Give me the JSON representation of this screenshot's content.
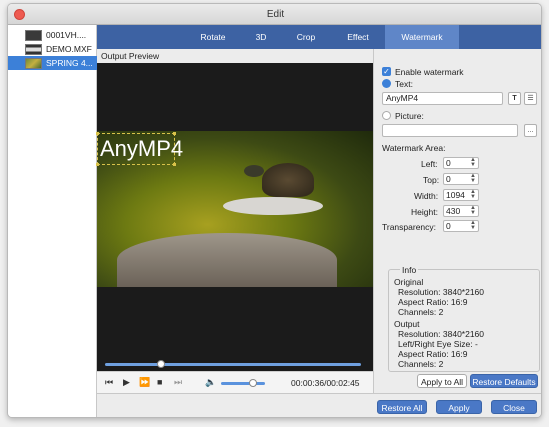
{
  "window": {
    "title": "Edit"
  },
  "files": [
    {
      "name": "0001VH...."
    },
    {
      "name": "DEMO.MXF"
    },
    {
      "name": "SPRING 4..."
    }
  ],
  "tabs": [
    "Rotate",
    "3D",
    "Crop",
    "Effect",
    "Watermark"
  ],
  "active_tab": "Watermark",
  "preview": {
    "label": "Output Preview",
    "watermark_text": "AnyMP4"
  },
  "player": {
    "time": "00:00:36/00:02:45",
    "progress": 0.22,
    "volume": 0.72
  },
  "watermark": {
    "enable_label": "Enable watermark",
    "text_label": "Text:",
    "text_value": "AnyMP4",
    "picture_label": "Picture:",
    "picture_value": "",
    "more_button": "...",
    "area_label": "Watermark Area:",
    "fields": [
      {
        "label": "Left:",
        "value": "0"
      },
      {
        "label": "Top:",
        "value": "0"
      },
      {
        "label": "Width:",
        "value": "1094"
      },
      {
        "label": "Height:",
        "value": "430"
      },
      {
        "label": "Transparency:",
        "value": "0"
      }
    ]
  },
  "info": {
    "title": "Info",
    "original_label": "Original",
    "original": [
      "Resolution: 3840*2160",
      "Aspect Ratio: 16:9",
      "Channels: 2"
    ],
    "output_label": "Output",
    "output": [
      "Resolution: 3840*2160",
      "Left/Right Eye Size: -",
      "Aspect Ratio: 16:9",
      "Channels: 2"
    ]
  },
  "buttons": {
    "apply_to_all": "Apply to All",
    "restore_defaults": "Restore Defaults",
    "restore_all": "Restore All",
    "apply": "Apply",
    "close": "Close"
  }
}
